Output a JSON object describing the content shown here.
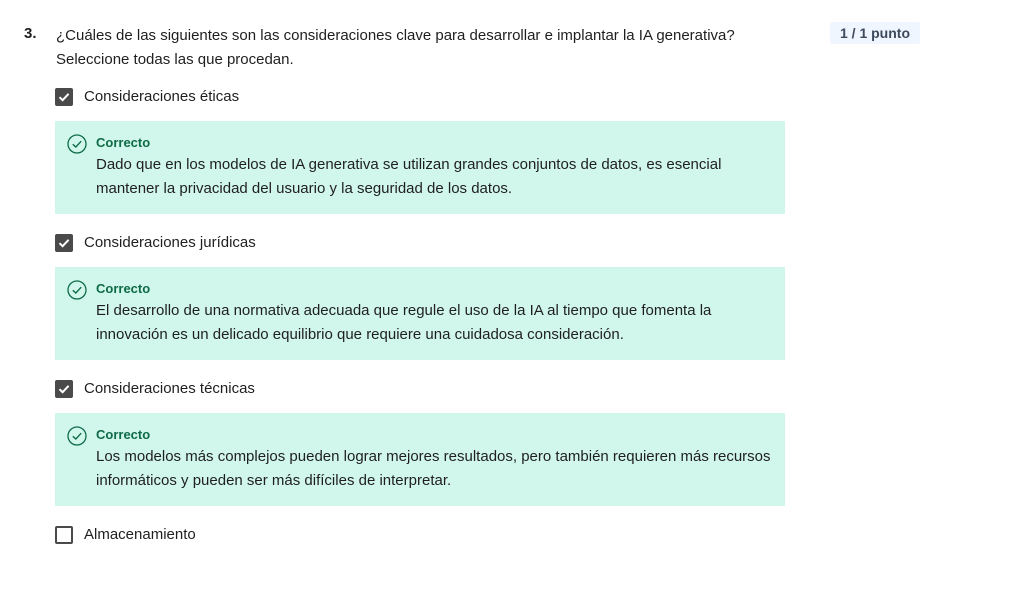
{
  "question": {
    "number": "3.",
    "prompt_line1": "¿Cuáles de las siguientes son las consideraciones clave para desarrollar e implantar la IA generativa?",
    "prompt_line2": "Seleccione todas las que procedan.",
    "score": "1 / 1 punto"
  },
  "options": [
    {
      "label": "Consideraciones éticas",
      "checked": true,
      "feedback_title": "Correcto",
      "feedback_text": "Dado que en los modelos de IA generativa se utilizan grandes conjuntos de datos, es esencial mantener la privacidad del usuario y la seguridad de los datos."
    },
    {
      "label": "Consideraciones jurídicas",
      "checked": true,
      "feedback_title": "Correcto",
      "feedback_text": "El desarrollo de una normativa adecuada que regule el uso de la IA al tiempo que fomenta la innovación es un delicado equilibrio que requiere una cuidadosa consideración."
    },
    {
      "label": "Consideraciones técnicas",
      "checked": true,
      "feedback_title": "Correcto",
      "feedback_text": "Los modelos más complejos pueden lograr mejores resultados, pero también requieren más recursos informáticos y pueden ser más difíciles de interpretar."
    },
    {
      "label": "Almacenamiento",
      "checked": false
    }
  ],
  "colors": {
    "feedback_bg": "#d1f7ec",
    "correct_green": "#0e6b47",
    "checkbox_fill": "#4a4a4a"
  },
  "icons": {
    "checked": "checkmark-icon",
    "feedback": "check-circle-icon"
  }
}
